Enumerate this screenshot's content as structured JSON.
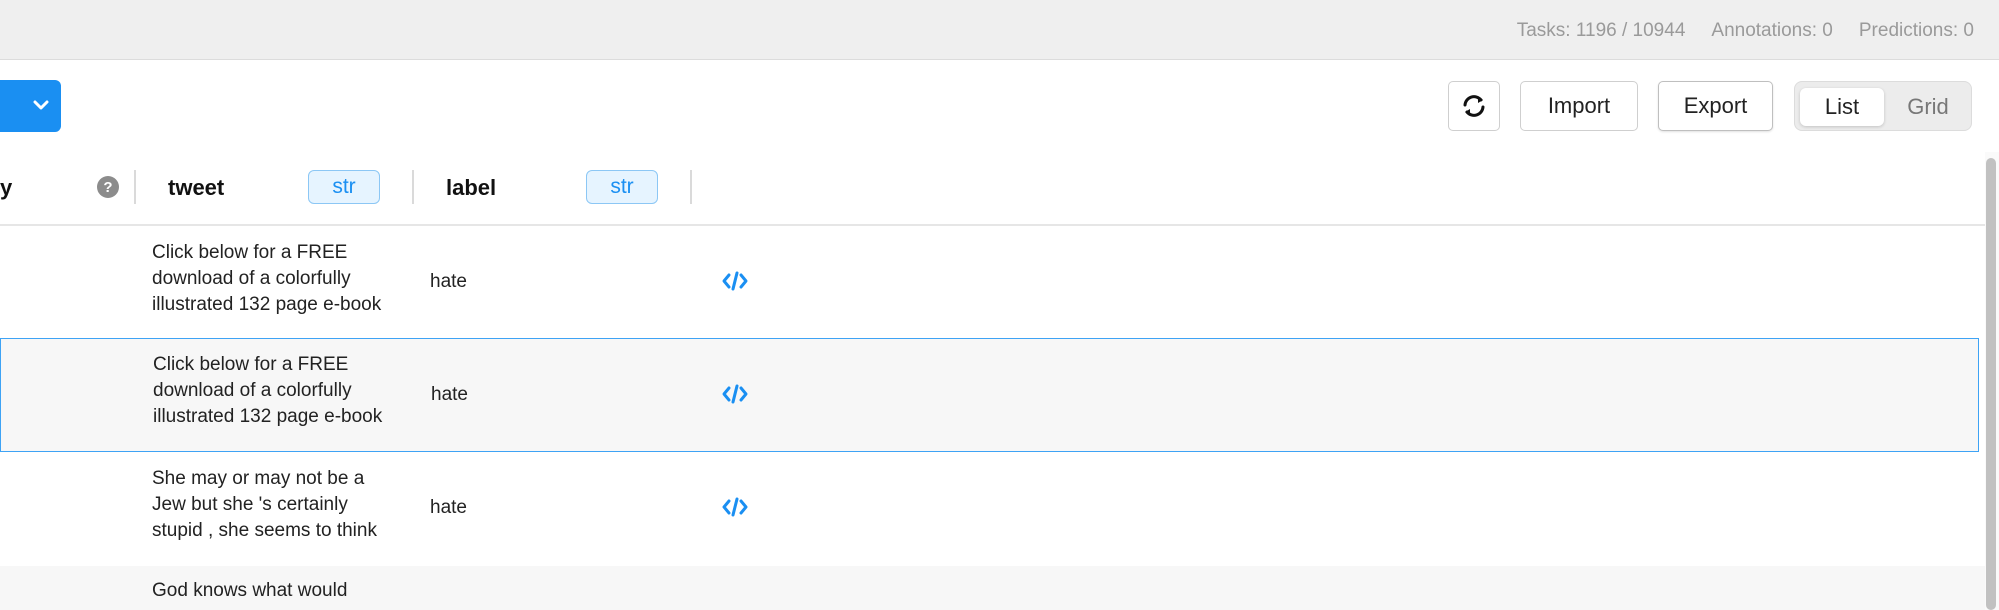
{
  "stats": {
    "tasks": "Tasks: 1196 / 10944",
    "annotations": "Annotations: 0",
    "predictions": "Predictions: 0"
  },
  "toolbar": {
    "import_label": "Import",
    "export_label": "Export",
    "view_list_label": "List",
    "view_grid_label": "Grid",
    "active_view": "List"
  },
  "columns": [
    {
      "label": "y"
    },
    {
      "label": "tweet",
      "type": "str"
    },
    {
      "label": "label",
      "type": "str"
    }
  ],
  "rows": [
    {
      "tweet": "Click below for a FREE download of a colorfully illustrated 132 page e-book",
      "label": "hate"
    },
    {
      "tweet": "Click below for a FREE download of a colorfully illustrated 132 page e-book",
      "label": "hate",
      "selected": true
    },
    {
      "tweet": "She may or may not be a Jew but she 's certainly stupid , she seems to think",
      "label": "hate"
    },
    {
      "tweet": "God knows what would",
      "label": ""
    }
  ],
  "colors": {
    "accent": "#1a8ff2",
    "badge_bg": "#e6f4ff",
    "selected_border": "#3ea3f5"
  }
}
